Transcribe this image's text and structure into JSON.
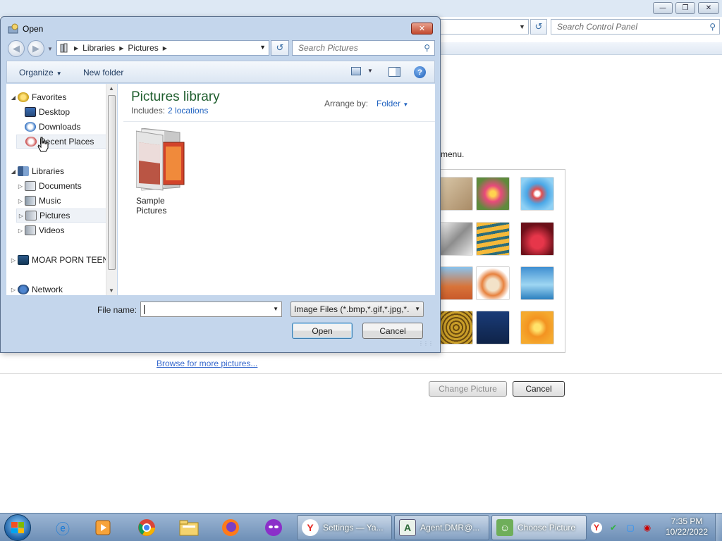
{
  "background_window": {
    "search_placeholder": "Search Control Panel",
    "menu_text_fragment": "menu.",
    "browse_link": "Browse for more pictures...",
    "change_picture_label": "Change Picture",
    "cancel_label": "Cancel",
    "minimize_glyph": "—",
    "restore_glyph": "❐",
    "close_glyph": "✕"
  },
  "dialog": {
    "title": "Open",
    "close_glyph": "✕",
    "breadcrumb": [
      "Libraries",
      "Pictures"
    ],
    "search_placeholder": "Search Pictures",
    "toolbar": {
      "organize_label": "Organize",
      "new_folder_label": "New folder",
      "help_glyph": "?"
    },
    "nav_pane": {
      "favorites_label": "Favorites",
      "favorites": [
        "Desktop",
        "Downloads",
        "Recent Places"
      ],
      "libraries_label": "Libraries",
      "libraries": [
        "Documents",
        "Music",
        "Pictures",
        "Videos"
      ],
      "drive_label": "MOAR PORN TEEN",
      "network_label": "Network"
    },
    "content": {
      "library_title": "Pictures library",
      "includes_label": "Includes:",
      "includes_link": "2 locations",
      "arrange_label": "Arrange by:",
      "arrange_value": "Folder",
      "folders": [
        "Sample Pictures"
      ]
    },
    "file_name_label": "File name:",
    "file_name_value": "",
    "file_type_value": "Image Files (*.bmp,*.gif,*.jpg,*.",
    "open_label": "Open",
    "cancel_label": "Cancel"
  },
  "taskbar": {
    "tasks": [
      {
        "label": "Settings — Ya...",
        "icon_glyph": "Y"
      },
      {
        "label": "Agent.DMR@...",
        "icon_glyph": "A"
      },
      {
        "label": "Choose Picture",
        "icon_glyph": "☺"
      }
    ],
    "clock_time": "7:35 PM",
    "clock_date": "10/22/2022"
  },
  "colors": {
    "link": "#3366cc",
    "library_title": "#1e5d2d",
    "accent_blue": "#1f62c0"
  }
}
